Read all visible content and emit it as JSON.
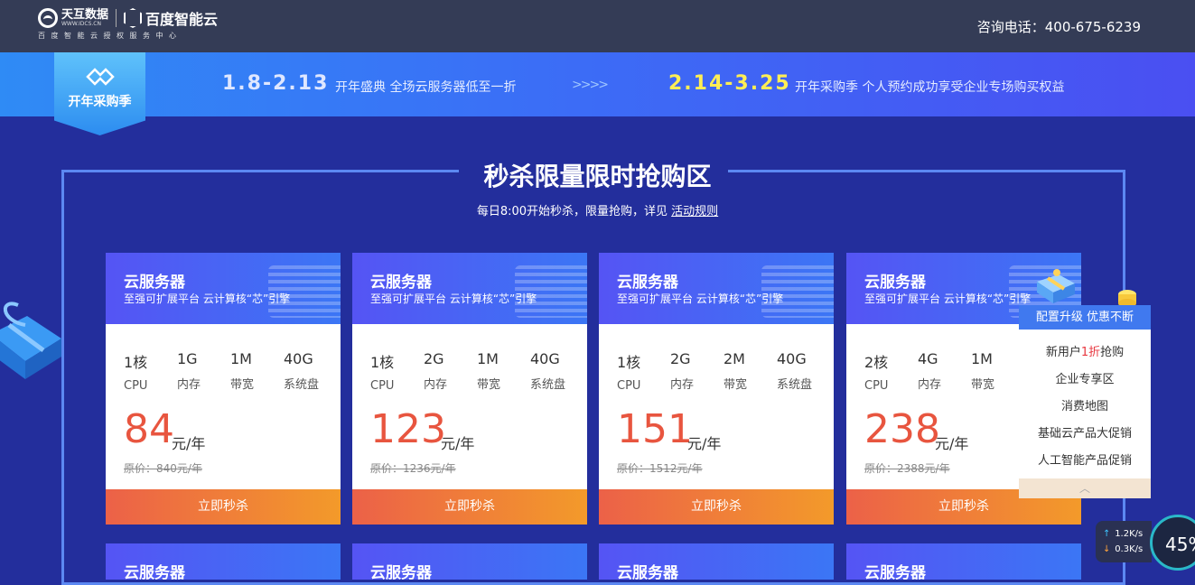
{
  "header": {
    "logo_name": "天互数据",
    "logo_url": "WWW.IDCS.CN",
    "partner": "百度智能云",
    "tagline": "百度智能云授权服务中心",
    "hotline": "咨询电话：400-675-6239"
  },
  "banner": {
    "badge": "开年采购季",
    "period1": "1.8-2.13",
    "promo1": "开年盛典 全场云服务器低至一折",
    "arrows": ">>>>",
    "period2": "2.14-3.25",
    "promo2": "开年采购季  个人预约成功享受企业专场购买权益"
  },
  "section": {
    "title": "秒杀限量限时抢购区",
    "subtitle_prefix": "每日8:00开始秒杀，限量抢购，详见",
    "rules_link": "活动规则"
  },
  "cards": [
    {
      "title": "云服务器",
      "desc": "至强可扩展平台 云计算核“芯”引擎",
      "cpu": "1核",
      "mem": "1G",
      "bw": "1M",
      "disk": "40G",
      "price": "84",
      "unit": "元/年",
      "orig": "原价：840元/年",
      "buy": "立即秒杀"
    },
    {
      "title": "云服务器",
      "desc": "至强可扩展平台 云计算核“芯”引擎",
      "cpu": "1核",
      "mem": "2G",
      "bw": "1M",
      "disk": "40G",
      "price": "123",
      "unit": "元/年",
      "orig": "原价：1236元/年",
      "buy": "立即秒杀"
    },
    {
      "title": "云服务器",
      "desc": "至强可扩展平台 云计算核“芯”引擎",
      "cpu": "1核",
      "mem": "2G",
      "bw": "2M",
      "disk": "40G",
      "price": "151",
      "unit": "元/年",
      "orig": "原价：1512元/年",
      "buy": "立即秒杀"
    },
    {
      "title": "云服务器",
      "desc": "至强可扩展平台 云计算核“芯”引擎",
      "cpu": "2核",
      "mem": "4G",
      "bw": "1M",
      "disk": "",
      "price": "238",
      "unit": "元/年",
      "orig": "原价：2388元/年",
      "buy": "立即秒杀"
    }
  ],
  "spec_labels": {
    "cpu": "CPU",
    "mem": "内存",
    "bw": "带宽",
    "disk": "系统盘"
  },
  "next_row_title": "云服务器",
  "float_panel": {
    "header": "配置升级 优惠不断",
    "item1_pre": "新用户",
    "item1_red": "1折",
    "item1_post": "抢购",
    "item2": "企业专享区",
    "item3": "消费地图",
    "item4": "基础云产品大促销",
    "item5": "人工智能产品促销",
    "collapse": "︿"
  },
  "speed_widget": {
    "up": "1.2K/s",
    "down": "0.3K/s",
    "percent": "45%"
  },
  "colors": {
    "page_bg": "#232e9c",
    "price": "#e8553f",
    "buy_start": "#ec6148",
    "buy_end": "#f39a2a",
    "header_bg": "#343c56"
  }
}
